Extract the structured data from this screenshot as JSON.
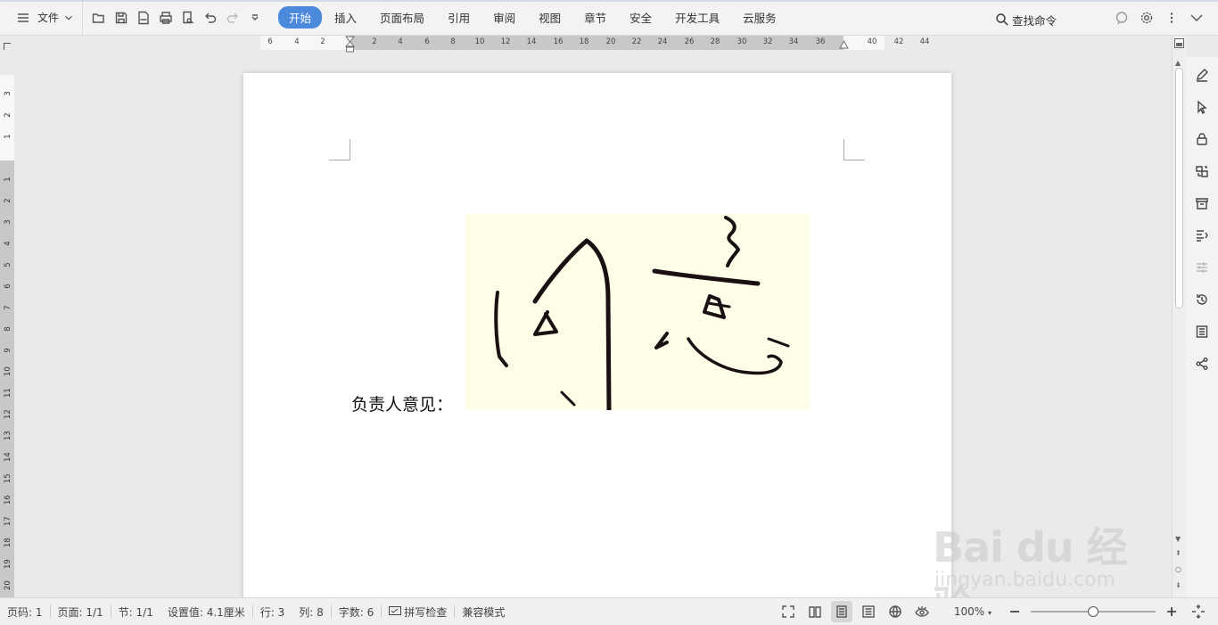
{
  "toolbar": {
    "file_label": "文件",
    "tabs": [
      {
        "label": "开始"
      },
      {
        "label": "插入"
      },
      {
        "label": "页面布局"
      },
      {
        "label": "引用"
      },
      {
        "label": "审阅"
      },
      {
        "label": "视图"
      },
      {
        "label": "章节"
      },
      {
        "label": "安全"
      },
      {
        "label": "开发工具"
      },
      {
        "label": "云服务"
      }
    ],
    "search_label": "查找命令"
  },
  "ruler": {
    "h_numbers": [
      "6",
      "4",
      "2",
      "2",
      "4",
      "6",
      "8",
      "10",
      "12",
      "14",
      "16",
      "18",
      "20",
      "22",
      "24",
      "26",
      "28",
      "30",
      "32",
      "34",
      "36",
      "40",
      "42",
      "44"
    ],
    "v_numbers": [
      "3",
      "2",
      "1",
      "1",
      "2",
      "3",
      "4",
      "5",
      "6",
      "7",
      "8",
      "9",
      "10",
      "11",
      "12",
      "13",
      "14",
      "15",
      "16",
      "17",
      "18",
      "19",
      "20"
    ]
  },
  "document": {
    "text": "负责人意见："
  },
  "status": {
    "page_code": "页码: 1",
    "pages": "页面: 1/1",
    "section": "节: 1/1",
    "setting": "设置值: 4.1厘米",
    "row": "行: 3",
    "col": "列: 8",
    "word_count": "字数: 6",
    "spell_check": "拼写检查",
    "compat_mode": "兼容模式",
    "zoom": "100%"
  },
  "watermark": {
    "main": "Bai du 经验",
    "sub": "jingyan.baidu.com"
  },
  "colors": {
    "accent": "#4a89dc",
    "signature_bg": "#fdfde8",
    "ink": "#1a1012"
  }
}
